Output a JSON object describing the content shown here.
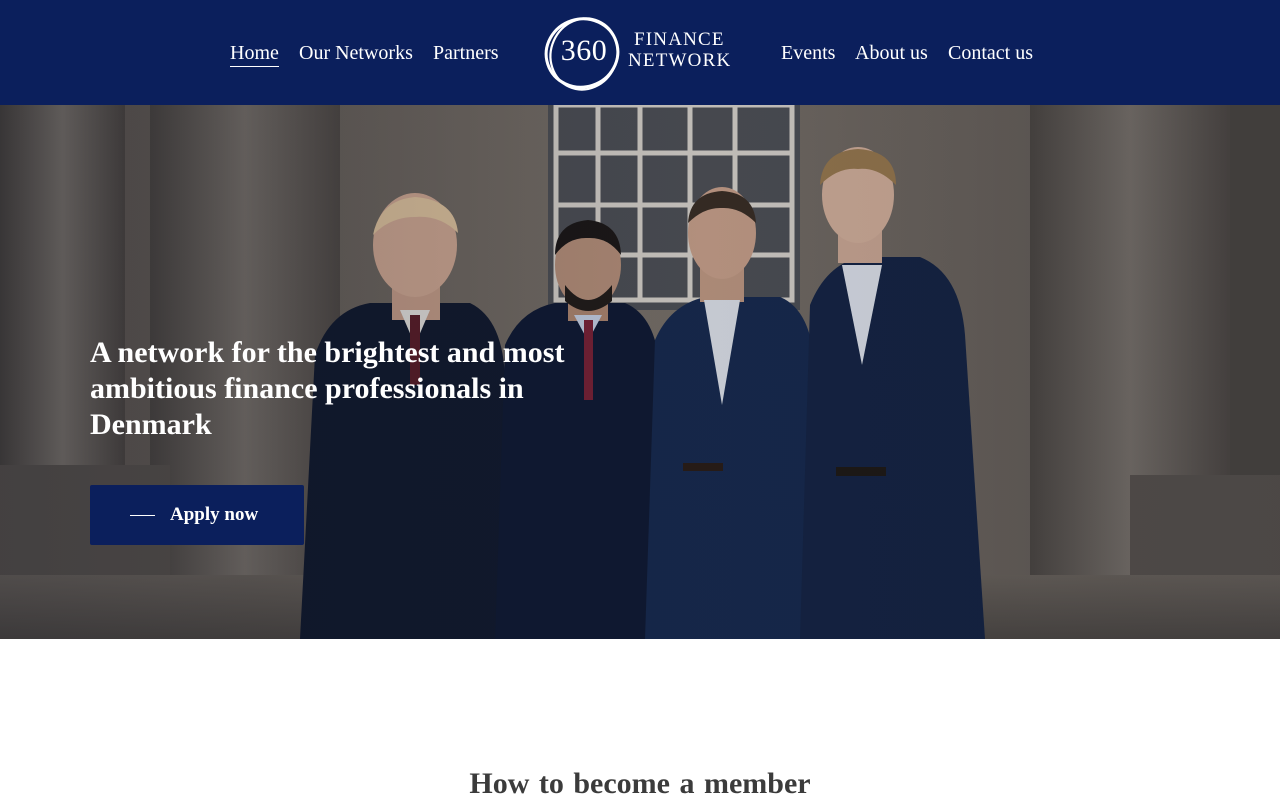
{
  "nav": {
    "left": [
      "Home",
      "Our Networks",
      "Partners"
    ],
    "right": [
      "Events",
      "About us",
      "Contact us"
    ],
    "active": "Home"
  },
  "logo": {
    "number": "360",
    "line1": "FINANCE",
    "line2": "NETWORK"
  },
  "hero": {
    "title": "A network for the brightest and most ambitious finance professionals in Denmark",
    "cta_label": "Apply now"
  },
  "section": {
    "title": "How to become a  member"
  },
  "colors": {
    "brand_navy": "#0b1f5c",
    "text_white": "#ffffff",
    "heading_gray": "#3b3b3b"
  },
  "icons": {
    "cta": "dash-line-icon"
  }
}
